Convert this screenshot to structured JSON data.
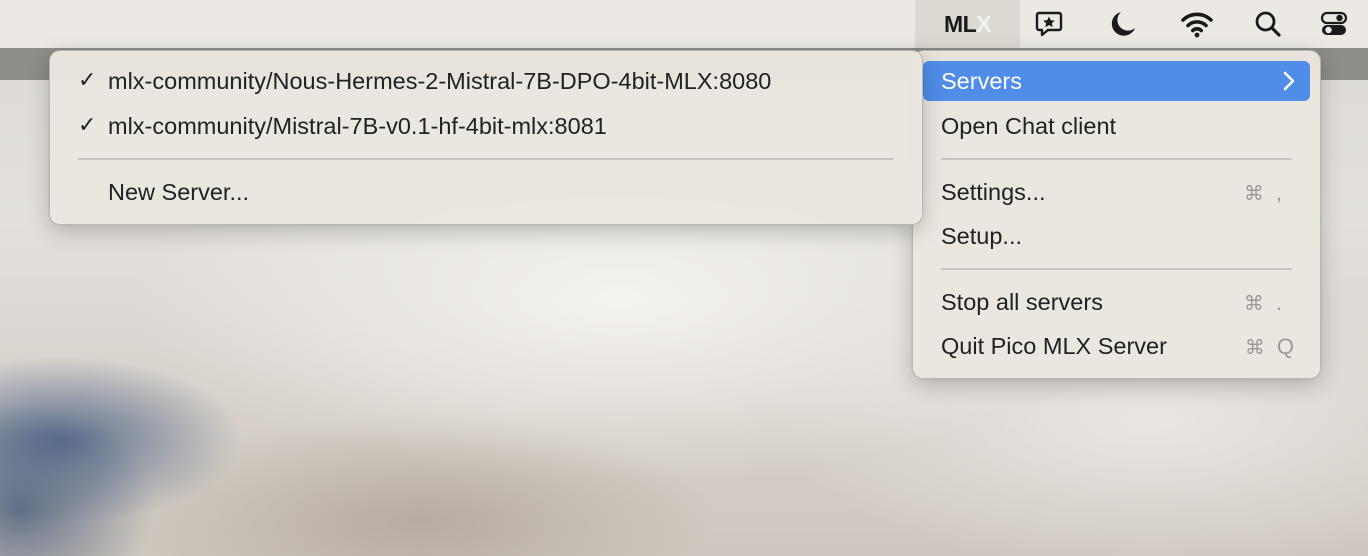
{
  "menubar": {
    "app_label_main": "ML",
    "app_label_dim": "X",
    "icons": [
      "chat-star-icon",
      "moon-icon",
      "wifi-icon",
      "search-icon",
      "control-center-icon"
    ]
  },
  "main_menu": {
    "servers": "Servers",
    "open_chat": "Open Chat client",
    "settings": "Settings...",
    "settings_shortcut_sym": "⌘",
    "settings_shortcut_key": ",",
    "setup": "Setup...",
    "stop_all": "Stop all servers",
    "stop_shortcut_sym": "⌘",
    "stop_shortcut_key": ".",
    "quit": "Quit Pico MLX Server",
    "quit_shortcut_sym": "⌘",
    "quit_shortcut_key": "Q"
  },
  "servers_submenu": {
    "check_symbol": "✓",
    "items": [
      {
        "label": "mlx-community/Nous-Hermes-2-Mistral-7B-DPO-4bit-MLX:8080",
        "checked": true
      },
      {
        "label": "mlx-community/Mistral-7B-v0.1-hf-4bit-mlx:8081",
        "checked": true
      }
    ],
    "new_server": "New Server..."
  },
  "colors": {
    "highlight": "#4f8de8",
    "shortcut_text": "#9d9a96"
  }
}
